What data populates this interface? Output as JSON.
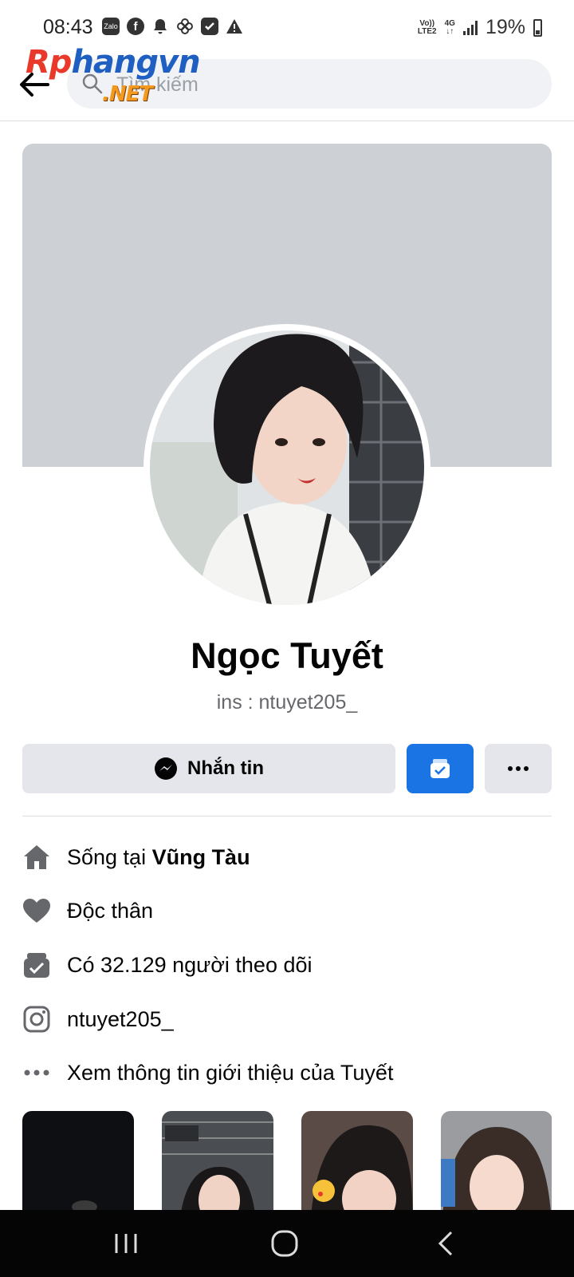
{
  "status_bar": {
    "time": "08:43",
    "zalo_label": "Zalo",
    "net_line1": "Vo))",
    "net_line2": "LTE2",
    "net_type": "4G",
    "battery": "19%"
  },
  "header": {
    "search_placeholder": "Tìm kiếm",
    "watermark_part1": "Rp",
    "watermark_part2": "hangvn",
    "watermark_part3": ".NET"
  },
  "profile": {
    "name": "Ngọc Tuyết",
    "bio": "ins : ntuyet205_"
  },
  "actions": {
    "message_label": "Nhắn tin"
  },
  "intro": {
    "lives_prefix": "Sống tại ",
    "lives_place": "Vũng Tàu",
    "relationship": "Độc thân",
    "followers": "Có 32.129 người theo dõi",
    "instagram": "ntuyet205_",
    "see_about": "Xem thông tin giới thiệu của Tuyết"
  },
  "colors": {
    "accent": "#1b74e4",
    "button_gray": "#e4e6eb",
    "cover_gray": "#cdd0d4",
    "icon_gray": "#65676b"
  },
  "icons": [
    "back-arrow-icon",
    "search-icon",
    "messenger-icon",
    "follow-check-icon",
    "more-dots-icon",
    "home-icon",
    "heart-icon",
    "followers-icon",
    "instagram-icon",
    "more-info-icon"
  ]
}
